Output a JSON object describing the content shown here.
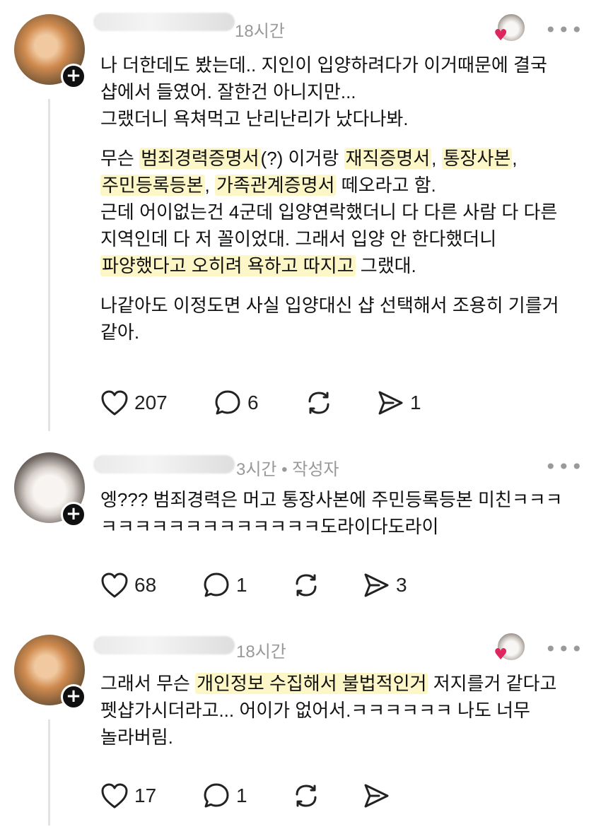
{
  "posts": [
    {
      "time": "18시간",
      "paragraphs": [
        [
          {
            "t": "나 더한데도 봤는데.. 지인이 입양하려다가 이거때문에 결국"
          }
        ],
        [
          {
            "t": "샵에서 들였어. 잘한건 아니지만..."
          }
        ],
        [
          {
            "t": "그랬더니 욕쳐먹고 난리난리가 났다나봐."
          }
        ]
      ],
      "paragraphs2": [
        "무슨 ",
        "범죄경력증명서",
        "(?) 이거랑 ",
        "재직증명서",
        ", ",
        "통장사본",
        ",",
        "주민등록등본",
        ", ",
        "가족관계증명서",
        " 떼오라고 함.",
        "근데 어이없는건 4군데 입양연락했더니 다 다른 사람 다 다른",
        "지역인데 다 저 꼴이었대. 그래서 입양 안 한다했더니",
        "파양했다고 오히려 욕하고 따지고",
        " 그랬대."
      ],
      "paragraphs3": [
        "나같아도 이정도면 사실 입양대신 샵 선택해서 조용히 기를거",
        "같아."
      ],
      "likes": "207",
      "replies": "6",
      "shares": "1"
    },
    {
      "time": "3시간 • 작성자",
      "lines": [
        "엥??? 범죄경력은 머고 통장사본에 주민등록등본 미친ㅋㅋㅋ",
        "ㅋㅋㅋㅋㅋㅋㅋㅋㅋㅋㅋㅋㅋ도라이다도라이"
      ],
      "likes": "68",
      "replies": "1",
      "shares": "3"
    },
    {
      "time": "18시간",
      "line1_pre": "그래서 무슨 ",
      "line1_mark": "개인정보 수집해서 불법적인거",
      "line1_post": " 저지를거 같다고",
      "line2": "펫샵가시더라고... 어이가 없어서.ㅋㅋㅋㅋㅋㅋ 나도 너무",
      "line3": "놀라버림.",
      "likes": "17",
      "replies": "1"
    }
  ],
  "ui": {
    "more": "•••",
    "plus": "+",
    "heart": "♥"
  },
  "icons": [
    "heart-outline-icon",
    "comment-bubble-icon",
    "repost-icon",
    "send-icon",
    "more-icon",
    "plus-icon"
  ]
}
